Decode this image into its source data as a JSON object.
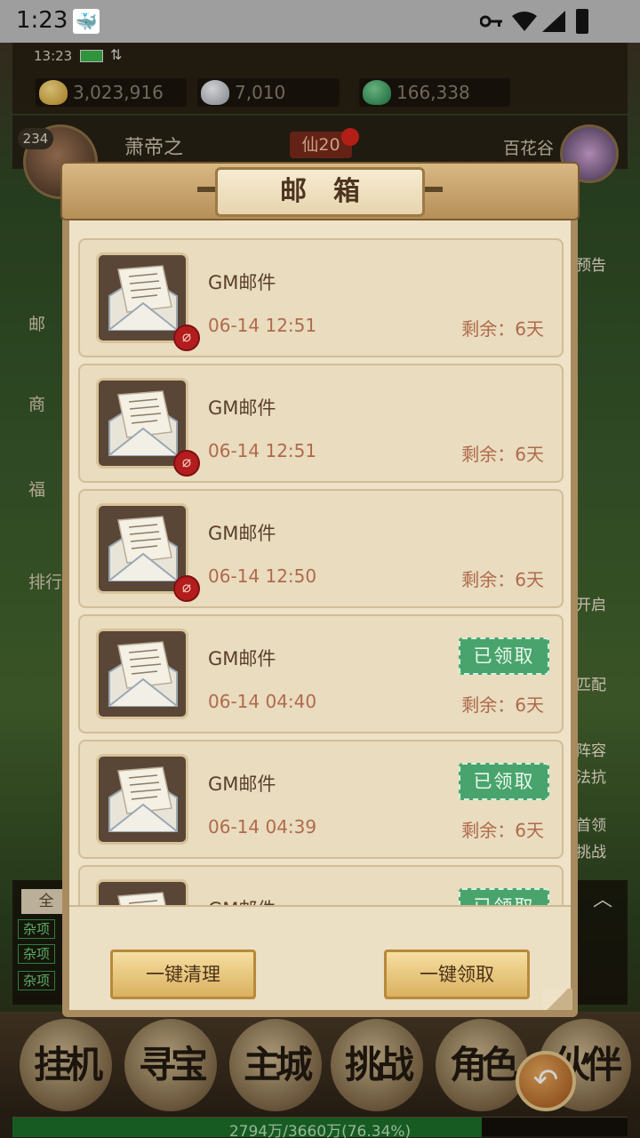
{
  "status_bar": {
    "time": "1:23",
    "notification_icon": "whale-icon",
    "icons": [
      "key-icon",
      "wifi-icon",
      "signal-icon",
      "battery-icon"
    ]
  },
  "game_header": {
    "clock": "13:23",
    "net": "⇅",
    "currencies": [
      {
        "icon": "gold-ingot-icon",
        "value": "3,023,916"
      },
      {
        "icon": "silver-ingot-icon",
        "value": "7,010"
      },
      {
        "icon": "jade-dragon-icon",
        "value": "166,338"
      }
    ]
  },
  "player": {
    "level": "234",
    "name": "萧帝之",
    "rank": "仙20",
    "location": "百花谷"
  },
  "side_left": [
    "邮",
    "商",
    "福",
    "排行"
  ],
  "side_right": [
    "预告",
    "开启",
    "匹配",
    "阵容",
    "法抗",
    "首领",
    "挑战"
  ],
  "chat": {
    "tab_all": "全",
    "tags": [
      "杂项",
      "杂项",
      "杂项"
    ]
  },
  "bottom_nav": [
    "挂机",
    "寻宝",
    "主城",
    "挑战",
    "角色",
    "伙伴"
  ],
  "exp": {
    "text": "2794万/3660万(76.34%)",
    "fraction": 0.7634
  },
  "mailbox": {
    "title": "邮箱",
    "items": [
      {
        "subject": "GM邮件",
        "time": "06-14 12:51",
        "remaining": "剩余：6天",
        "has_attachment": true,
        "claimed": false
      },
      {
        "subject": "GM邮件",
        "time": "06-14 12:51",
        "remaining": "剩余：6天",
        "has_attachment": true,
        "claimed": false
      },
      {
        "subject": "GM邮件",
        "time": "06-14 12:50",
        "remaining": "剩余：6天",
        "has_attachment": true,
        "claimed": false
      },
      {
        "subject": "GM邮件",
        "time": "06-14 04:40",
        "remaining": "剩余：6天",
        "has_attachment": false,
        "claimed": true,
        "claimed_label": "已领取"
      },
      {
        "subject": "GM邮件",
        "time": "06-14 04:39",
        "remaining": "剩余：6天",
        "has_attachment": false,
        "claimed": true,
        "claimed_label": "已领取"
      },
      {
        "subject": "GM邮件",
        "time": "",
        "remaining": "",
        "has_attachment": false,
        "claimed": true,
        "claimed_label": "已领取"
      }
    ],
    "clear_all_label": "一键清理",
    "claim_all_label": "一键领取"
  }
}
